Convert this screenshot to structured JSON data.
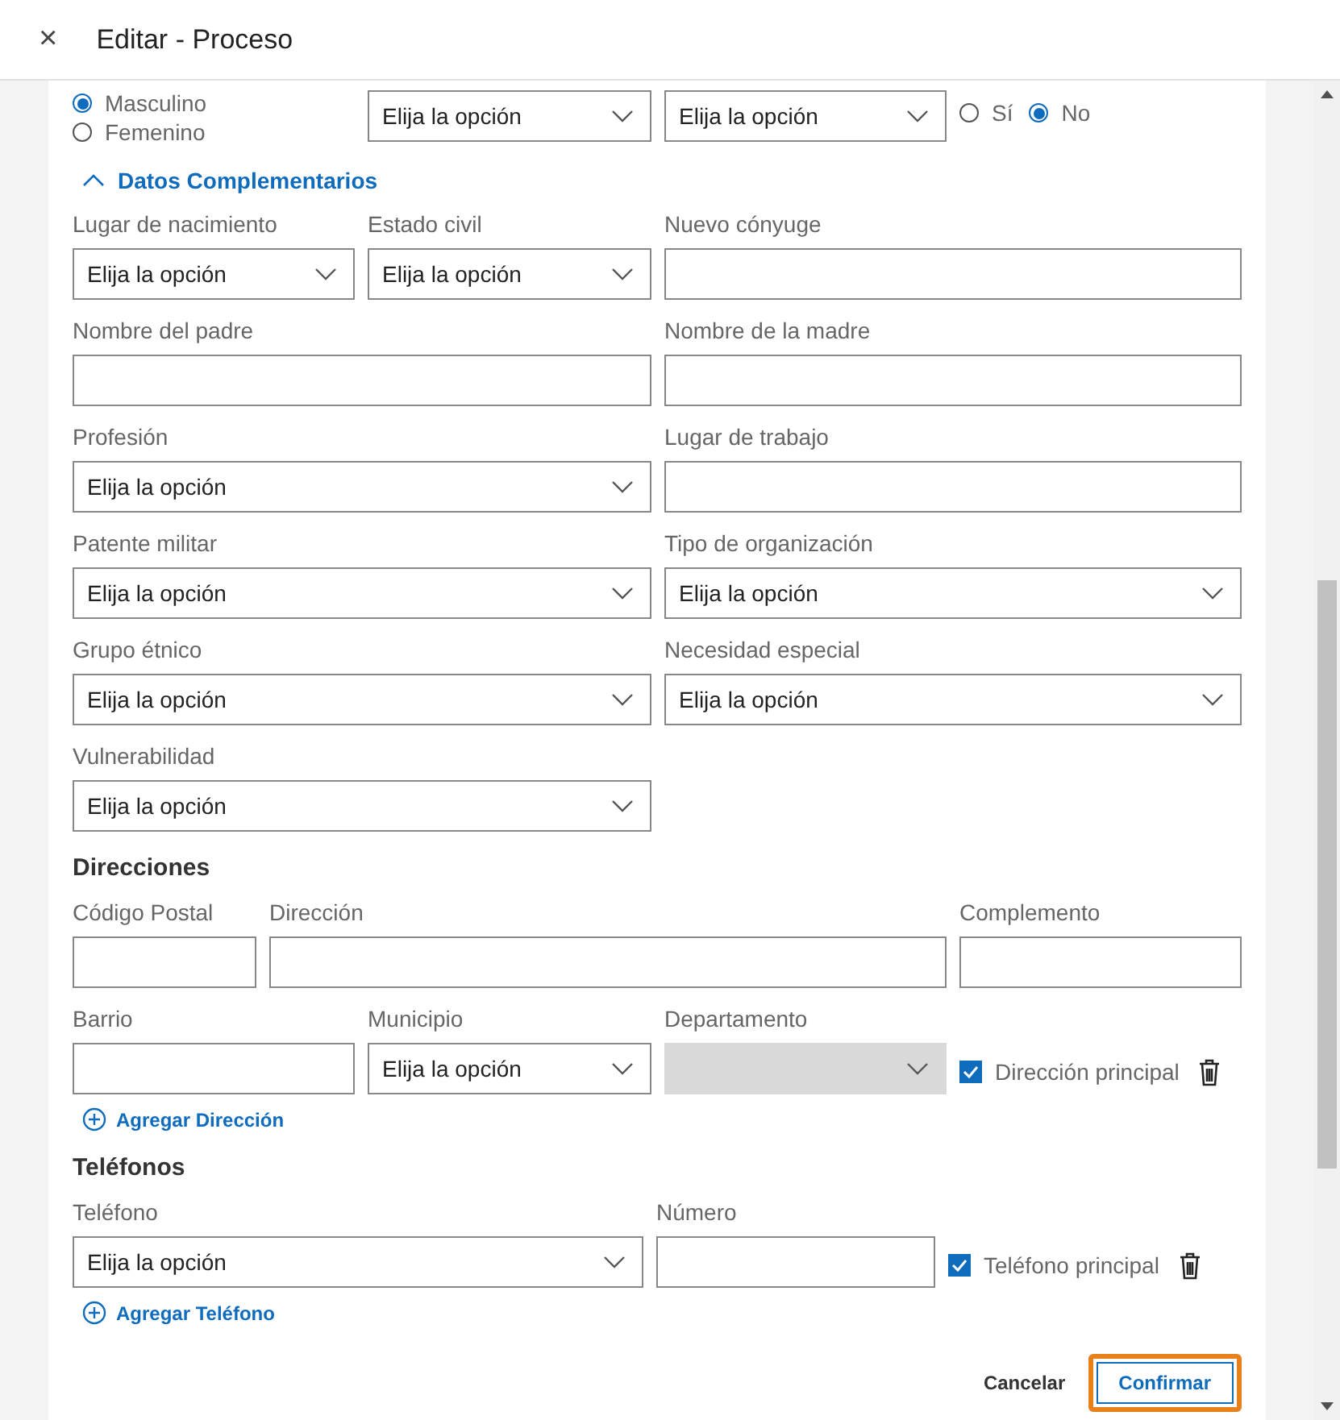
{
  "window": {
    "title": "Editar - Proceso",
    "close": "×"
  },
  "top_row": {
    "gender": [
      {
        "label": "Masculino",
        "selected": true
      },
      {
        "label": "Femenino",
        "selected": false
      }
    ],
    "selects": [
      {
        "value": "Elija la opción"
      },
      {
        "value": "Elija la opción"
      }
    ],
    "yes_no": [
      {
        "label": "Sí",
        "selected": false
      },
      {
        "label": "No",
        "selected": true
      }
    ]
  },
  "complementary": {
    "title": "Datos Complementarios",
    "expanded": true,
    "rows": [
      [
        {
          "kind": "select",
          "label": "Lugar de nacimiento",
          "value": "Elija la opción"
        },
        {
          "kind": "select",
          "label": "Estado civil",
          "value": "Elija la opción"
        },
        {
          "kind": "input",
          "label": "Nuevo cónyuge"
        }
      ],
      [
        {
          "kind": "input",
          "label": "Nombre del padre"
        },
        {
          "kind": "input",
          "label": "Nombre de la madre"
        }
      ],
      [
        {
          "kind": "select",
          "label": "Profesión",
          "value": "Elija la opción"
        },
        {
          "kind": "input",
          "label": "Lugar de trabajo"
        }
      ],
      [
        {
          "kind": "select",
          "label": "Patente militar",
          "value": "Elija la opción"
        },
        {
          "kind": "select",
          "label": "Tipo de organización",
          "value": "Elija la opción"
        }
      ],
      [
        {
          "kind": "select",
          "label": "Grupo étnico",
          "value": "Elija la opción"
        },
        {
          "kind": "select",
          "label": "Necesidad especial",
          "value": "Elija la opción"
        }
      ],
      [
        {
          "kind": "select",
          "label": "Vulnerabilidad",
          "value": "Elija la opción"
        }
      ]
    ]
  },
  "addresses": {
    "title": "Direcciones",
    "row1": [
      {
        "kind": "input",
        "label": "Código Postal"
      },
      {
        "kind": "input",
        "label": "Dirección"
      },
      {
        "kind": "input",
        "label": "Complemento"
      }
    ],
    "row2": [
      {
        "kind": "input",
        "label": "Barrio"
      },
      {
        "kind": "select",
        "label": "Municipio",
        "value": "Elija la opción"
      },
      {
        "kind": "select",
        "label": "Departamento",
        "disabled": true
      }
    ],
    "principal": {
      "label": "Dirección principal",
      "checked": true
    },
    "add": "Agregar Dirección"
  },
  "phones": {
    "title": "Teléfonos",
    "row": [
      {
        "kind": "select",
        "label": "Teléfono",
        "value": "Elija la opción"
      },
      {
        "kind": "input",
        "label": "Número"
      }
    ],
    "principal": {
      "label": "Teléfono principal",
      "checked": true
    },
    "add": "Agregar Teléfono"
  },
  "actions": [
    {
      "label": "Cancelar",
      "kind": "text",
      "highlighted": false
    },
    {
      "label": "Confirmar",
      "kind": "outline",
      "highlighted": true
    }
  ]
}
